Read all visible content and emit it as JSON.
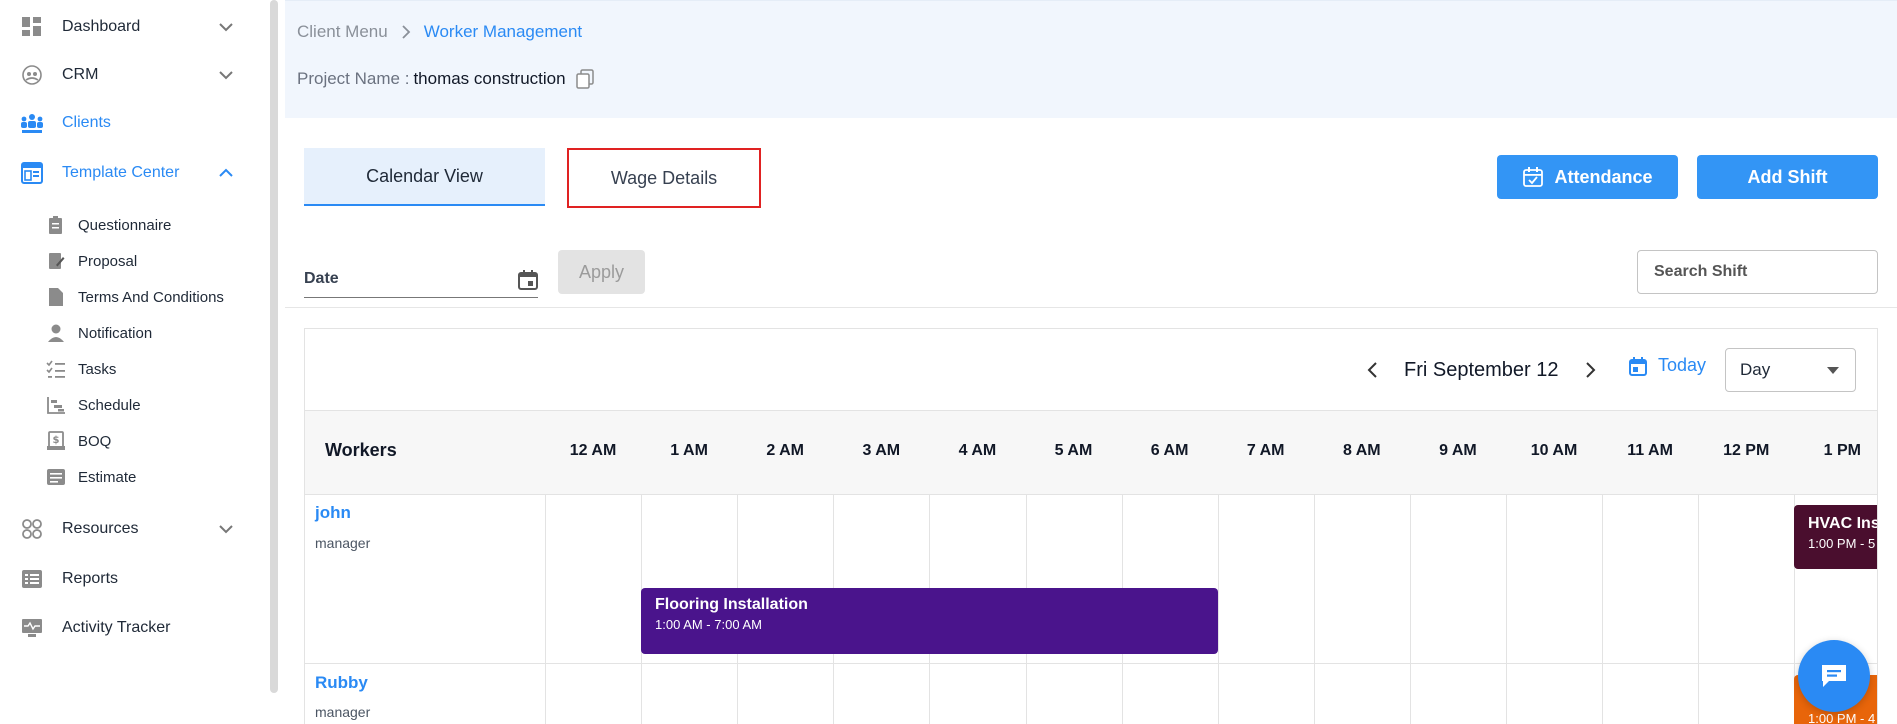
{
  "sidebar": {
    "items": [
      {
        "label": "Dashboard",
        "icon": "dashboard-icon",
        "has_chevron": true
      },
      {
        "label": "CRM",
        "icon": "crm-icon",
        "has_chevron": true
      },
      {
        "label": "Clients",
        "icon": "clients-icon",
        "active": true
      },
      {
        "label": "Template Center",
        "icon": "template-center-icon",
        "expanded": true
      },
      {
        "label": "Resources",
        "icon": "resources-icon",
        "has_chevron": true
      },
      {
        "label": "Reports",
        "icon": "reports-icon"
      },
      {
        "label": "Activity Tracker",
        "icon": "activity-tracker-icon"
      }
    ],
    "sub_items": [
      {
        "label": "Questionnaire",
        "icon": "questionnaire-icon"
      },
      {
        "label": "Proposal",
        "icon": "proposal-icon"
      },
      {
        "label": "Terms And Conditions",
        "icon": "document-icon"
      },
      {
        "label": "Notification",
        "icon": "notification-user-icon"
      },
      {
        "label": "Tasks",
        "icon": "tasks-icon"
      },
      {
        "label": "Schedule",
        "icon": "schedule-icon"
      },
      {
        "label": "BOQ",
        "icon": "boq-icon"
      },
      {
        "label": "Estimate",
        "icon": "estimate-icon"
      }
    ]
  },
  "breadcrumb": {
    "parent": "Client Menu",
    "current": "Worker Management"
  },
  "project": {
    "label": "Project Name :",
    "value": "thomas construction"
  },
  "tabs": {
    "calendar": "Calendar View",
    "wage": "Wage Details"
  },
  "buttons": {
    "attendance": "Attendance",
    "add_shift": "Add Shift",
    "apply": "Apply"
  },
  "filter": {
    "date_label": "Date",
    "search_placeholder": "Search Shift"
  },
  "calendar": {
    "current_date": "Fri September 12",
    "today_label": "Today",
    "view": "Day",
    "workers_header": "Workers",
    "hours": [
      "12 AM",
      "1 AM",
      "2 AM",
      "3 AM",
      "4 AM",
      "5 AM",
      "6 AM",
      "7 AM",
      "8 AM",
      "9 AM",
      "10 AM",
      "11 AM",
      "12 PM",
      "1 PM"
    ],
    "workers": [
      {
        "name": "john",
        "role": "manager"
      },
      {
        "name": "Rubby",
        "role": "manager"
      }
    ],
    "events": [
      {
        "title": "Flooring Installation",
        "time": "1:00 AM - 7:00 AM",
        "worker": "john",
        "color": "#4a148c"
      },
      {
        "title": "HVAC Ins",
        "time": "1:00 PM - 5",
        "worker": "john",
        "color": "#4a0e2e"
      },
      {
        "title": "",
        "time": "1:00 PM - 4",
        "worker": "Rubby",
        "color": "#e8650a"
      }
    ]
  },
  "colors": {
    "accent": "#2a8af4",
    "button": "#3395f5",
    "highlight_border": "#e02222"
  }
}
